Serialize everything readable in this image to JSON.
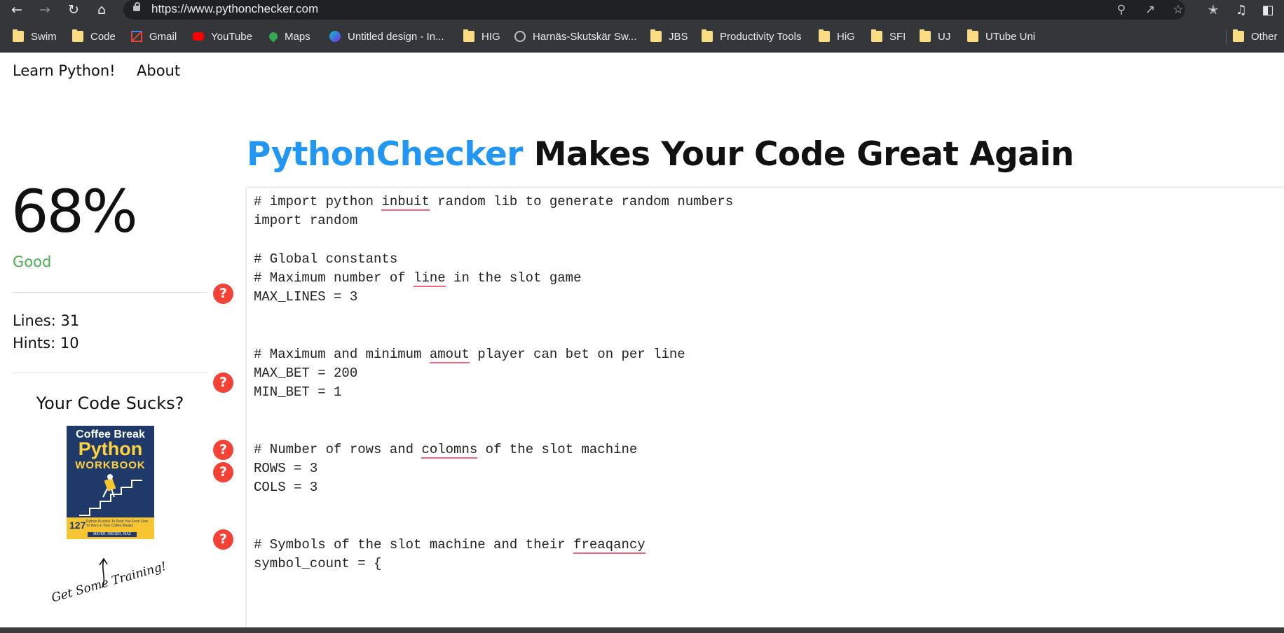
{
  "browser": {
    "url": "https://www.pythonchecker.com",
    "icons": [
      "back-icon",
      "forward-icon",
      "reload-icon",
      "home-icon",
      "search-icon",
      "share-icon",
      "star-icon",
      "extensions-icon",
      "media-icon",
      "sidepanel-icon"
    ],
    "bookmarks": [
      {
        "label": "Swim",
        "icon": "folder"
      },
      {
        "label": "Code",
        "icon": "folder"
      },
      {
        "label": "Gmail",
        "icon": "gmail"
      },
      {
        "label": "YouTube",
        "icon": "youtube"
      },
      {
        "label": "Maps",
        "icon": "maps"
      },
      {
        "label": "Untitled design - In...",
        "icon": "canva"
      },
      {
        "label": "HIG",
        "icon": "folder"
      },
      {
        "label": "Harnäs-Skutskär Sw...",
        "icon": "globe"
      },
      {
        "label": "JBS",
        "icon": "folder"
      },
      {
        "label": "Productivity Tools",
        "icon": "folder"
      },
      {
        "label": "HiG",
        "icon": "folder"
      },
      {
        "label": "SFI",
        "icon": "folder"
      },
      {
        "label": "UJ",
        "icon": "folder"
      },
      {
        "label": "UTube Uni",
        "icon": "folder"
      }
    ],
    "other_bookmarks": "Other"
  },
  "nav": {
    "learn": "Learn Python!",
    "about": "About"
  },
  "title": {
    "brand": "PythonChecker",
    "rest": " Makes Your Code Great Again"
  },
  "sidebar": {
    "score": "68%",
    "rating": "Good",
    "lines": "Lines: 31",
    "hints": "Hints: 10",
    "promo_heading": "Your Code Sucks?",
    "book": {
      "line1": "Coffee Break",
      "line2": "Python",
      "line3": "WORKBOOK",
      "number": "127",
      "subtitle": "Python Puzzles To Push You From Zero To Hero in Your Coffee Breaks",
      "authors": "MAYER, RIEGER, RIAZ"
    },
    "training": "Get Some Training!",
    "hint_symbol": "?"
  },
  "colors": {
    "brand": "#2196f3",
    "good": "#4caf50",
    "hint": "#f44336",
    "spell_underline": "#f06583"
  },
  "code": {
    "lines": [
      {
        "segments": [
          {
            "t": "# import python "
          },
          {
            "t": "inbuit",
            "sp": true
          },
          {
            "t": " random lib to generate random numbers"
          }
        ]
      },
      {
        "segments": [
          {
            "t": "import random"
          }
        ]
      },
      {
        "segments": []
      },
      {
        "segments": [
          {
            "t": "# Global constants"
          }
        ]
      },
      {
        "segments": [
          {
            "t": "# Maximum number of "
          },
          {
            "t": "line",
            "sp": true
          },
          {
            "t": " in the slot game"
          }
        ]
      },
      {
        "segments": [
          {
            "t": "MAX_LINES = 3"
          }
        ]
      },
      {
        "segments": []
      },
      {
        "segments": []
      },
      {
        "segments": [
          {
            "t": "# Maximum and minimum "
          },
          {
            "t": "amout",
            "sp": true
          },
          {
            "t": " player can bet on per line"
          }
        ]
      },
      {
        "segments": [
          {
            "t": "MAX_BET = 200"
          }
        ]
      },
      {
        "segments": [
          {
            "t": "MIN_BET = 1"
          }
        ]
      },
      {
        "segments": []
      },
      {
        "segments": []
      },
      {
        "segments": [
          {
            "t": "# Number of rows and "
          },
          {
            "t": "colomns",
            "sp": true
          },
          {
            "t": " of the slot machine"
          }
        ]
      },
      {
        "segments": [
          {
            "t": "ROWS = 3"
          }
        ]
      },
      {
        "segments": [
          {
            "t": "COLS = 3"
          }
        ]
      },
      {
        "segments": []
      },
      {
        "segments": []
      },
      {
        "segments": [
          {
            "t": "# Symbols of the slot machine and their "
          },
          {
            "t": "freaqancy",
            "sp": true
          }
        ]
      },
      {
        "segments": [
          {
            "t": "symbol_count = {"
          }
        ]
      }
    ]
  }
}
